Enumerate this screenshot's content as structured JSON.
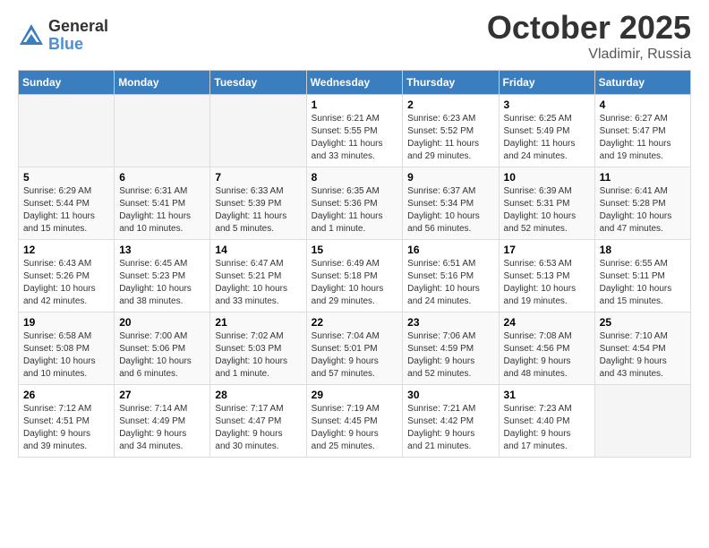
{
  "logo": {
    "general": "General",
    "blue": "Blue"
  },
  "title": {
    "month": "October 2025",
    "location": "Vladimir, Russia"
  },
  "headers": [
    "Sunday",
    "Monday",
    "Tuesday",
    "Wednesday",
    "Thursday",
    "Friday",
    "Saturday"
  ],
  "weeks": [
    [
      {
        "day": "",
        "info": ""
      },
      {
        "day": "",
        "info": ""
      },
      {
        "day": "",
        "info": ""
      },
      {
        "day": "1",
        "info": "Sunrise: 6:21 AM\nSunset: 5:55 PM\nDaylight: 11 hours\nand 33 minutes."
      },
      {
        "day": "2",
        "info": "Sunrise: 6:23 AM\nSunset: 5:52 PM\nDaylight: 11 hours\nand 29 minutes."
      },
      {
        "day": "3",
        "info": "Sunrise: 6:25 AM\nSunset: 5:49 PM\nDaylight: 11 hours\nand 24 minutes."
      },
      {
        "day": "4",
        "info": "Sunrise: 6:27 AM\nSunset: 5:47 PM\nDaylight: 11 hours\nand 19 minutes."
      }
    ],
    [
      {
        "day": "5",
        "info": "Sunrise: 6:29 AM\nSunset: 5:44 PM\nDaylight: 11 hours\nand 15 minutes."
      },
      {
        "day": "6",
        "info": "Sunrise: 6:31 AM\nSunset: 5:41 PM\nDaylight: 11 hours\nand 10 minutes."
      },
      {
        "day": "7",
        "info": "Sunrise: 6:33 AM\nSunset: 5:39 PM\nDaylight: 11 hours\nand 5 minutes."
      },
      {
        "day": "8",
        "info": "Sunrise: 6:35 AM\nSunset: 5:36 PM\nDaylight: 11 hours\nand 1 minute."
      },
      {
        "day": "9",
        "info": "Sunrise: 6:37 AM\nSunset: 5:34 PM\nDaylight: 10 hours\nand 56 minutes."
      },
      {
        "day": "10",
        "info": "Sunrise: 6:39 AM\nSunset: 5:31 PM\nDaylight: 10 hours\nand 52 minutes."
      },
      {
        "day": "11",
        "info": "Sunrise: 6:41 AM\nSunset: 5:28 PM\nDaylight: 10 hours\nand 47 minutes."
      }
    ],
    [
      {
        "day": "12",
        "info": "Sunrise: 6:43 AM\nSunset: 5:26 PM\nDaylight: 10 hours\nand 42 minutes."
      },
      {
        "day": "13",
        "info": "Sunrise: 6:45 AM\nSunset: 5:23 PM\nDaylight: 10 hours\nand 38 minutes."
      },
      {
        "day": "14",
        "info": "Sunrise: 6:47 AM\nSunset: 5:21 PM\nDaylight: 10 hours\nand 33 minutes."
      },
      {
        "day": "15",
        "info": "Sunrise: 6:49 AM\nSunset: 5:18 PM\nDaylight: 10 hours\nand 29 minutes."
      },
      {
        "day": "16",
        "info": "Sunrise: 6:51 AM\nSunset: 5:16 PM\nDaylight: 10 hours\nand 24 minutes."
      },
      {
        "day": "17",
        "info": "Sunrise: 6:53 AM\nSunset: 5:13 PM\nDaylight: 10 hours\nand 19 minutes."
      },
      {
        "day": "18",
        "info": "Sunrise: 6:55 AM\nSunset: 5:11 PM\nDaylight: 10 hours\nand 15 minutes."
      }
    ],
    [
      {
        "day": "19",
        "info": "Sunrise: 6:58 AM\nSunset: 5:08 PM\nDaylight: 10 hours\nand 10 minutes."
      },
      {
        "day": "20",
        "info": "Sunrise: 7:00 AM\nSunset: 5:06 PM\nDaylight: 10 hours\nand 6 minutes."
      },
      {
        "day": "21",
        "info": "Sunrise: 7:02 AM\nSunset: 5:03 PM\nDaylight: 10 hours\nand 1 minute."
      },
      {
        "day": "22",
        "info": "Sunrise: 7:04 AM\nSunset: 5:01 PM\nDaylight: 9 hours\nand 57 minutes."
      },
      {
        "day": "23",
        "info": "Sunrise: 7:06 AM\nSunset: 4:59 PM\nDaylight: 9 hours\nand 52 minutes."
      },
      {
        "day": "24",
        "info": "Sunrise: 7:08 AM\nSunset: 4:56 PM\nDaylight: 9 hours\nand 48 minutes."
      },
      {
        "day": "25",
        "info": "Sunrise: 7:10 AM\nSunset: 4:54 PM\nDaylight: 9 hours\nand 43 minutes."
      }
    ],
    [
      {
        "day": "26",
        "info": "Sunrise: 7:12 AM\nSunset: 4:51 PM\nDaylight: 9 hours\nand 39 minutes."
      },
      {
        "day": "27",
        "info": "Sunrise: 7:14 AM\nSunset: 4:49 PM\nDaylight: 9 hours\nand 34 minutes."
      },
      {
        "day": "28",
        "info": "Sunrise: 7:17 AM\nSunset: 4:47 PM\nDaylight: 9 hours\nand 30 minutes."
      },
      {
        "day": "29",
        "info": "Sunrise: 7:19 AM\nSunset: 4:45 PM\nDaylight: 9 hours\nand 25 minutes."
      },
      {
        "day": "30",
        "info": "Sunrise: 7:21 AM\nSunset: 4:42 PM\nDaylight: 9 hours\nand 21 minutes."
      },
      {
        "day": "31",
        "info": "Sunrise: 7:23 AM\nSunset: 4:40 PM\nDaylight: 9 hours\nand 17 minutes."
      },
      {
        "day": "",
        "info": ""
      }
    ]
  ]
}
